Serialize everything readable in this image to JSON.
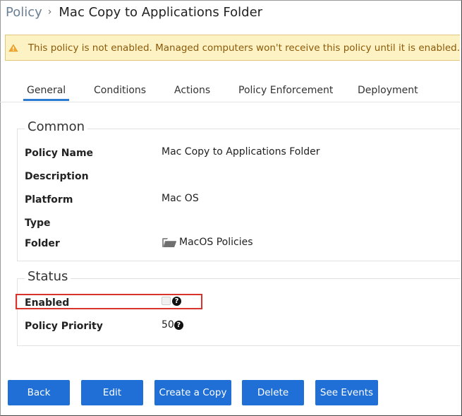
{
  "breadcrumb": {
    "root": "Policy",
    "separator": "›",
    "title": "Mac Copy to Applications Folder"
  },
  "warning": {
    "text": "This policy is not enabled. Managed computers won't receive this policy until it is enabled."
  },
  "tabs": [
    "General",
    "Conditions",
    "Actions",
    "Policy Enforcement",
    "Deployment"
  ],
  "common": {
    "legend": "Common",
    "policy_name_label": "Policy Name",
    "policy_name_value": "Mac Copy to Applications Folder",
    "description_label": "Description",
    "description_value": "",
    "platform_label": "Platform",
    "platform_value": "Mac OS",
    "type_label": "Type",
    "type_value": "",
    "folder_label": "Folder",
    "folder_value": "MacOS Policies"
  },
  "status": {
    "legend": "Status",
    "enabled_label": "Enabled",
    "enabled_checked": false,
    "priority_label": "Policy Priority",
    "priority_value": "50",
    "help_glyph": "?"
  },
  "buttons": {
    "back": "Back",
    "edit": "Edit",
    "copy": "Create a Copy",
    "delete": "Delete",
    "events": "See Events"
  },
  "colors": {
    "accent": "#1f6fd6",
    "tab_underline": "#2b7bd1",
    "warning_bg": "#fdf2c3",
    "highlight": "#d9342b"
  },
  "icons": [
    "warning-icon",
    "folder-icon",
    "help-icon",
    "checkbox"
  ]
}
